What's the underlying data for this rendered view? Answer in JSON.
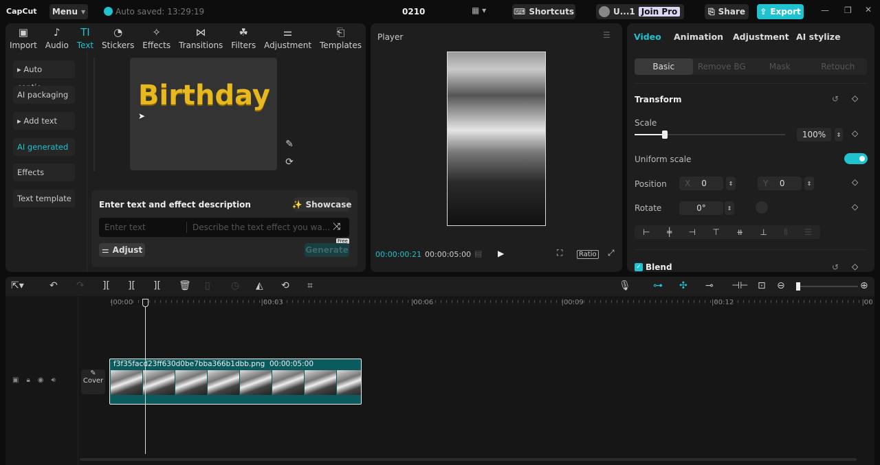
{
  "app": {
    "logo": "CapCut",
    "menu": "Menu",
    "autosave": "Auto saved: 13:29:19",
    "project": "0210",
    "shortcuts": "Shortcuts",
    "user": "U...1",
    "join_pro": "Join Pro",
    "share": "Share",
    "export": "Export"
  },
  "toolbar": [
    {
      "label": "Import",
      "icon": "▣"
    },
    {
      "label": "Audio",
      "icon": "♪"
    },
    {
      "label": "Text",
      "icon": "TI"
    },
    {
      "label": "Stickers",
      "icon": "◔"
    },
    {
      "label": "Effects",
      "icon": "✧"
    },
    {
      "label": "Transitions",
      "icon": "⋈"
    },
    {
      "label": "Filters",
      "icon": "☘"
    },
    {
      "label": "Adjustment",
      "icon": "⚌"
    },
    {
      "label": "Templates",
      "icon": "⎗"
    }
  ],
  "sidebar": [
    "▸ Auto captio...",
    "AI packaging",
    "▸ Add text",
    "AI generated",
    "Effects",
    "Text template"
  ],
  "preview": {
    "word": "Birthday"
  },
  "generator": {
    "title": "Enter text and effect description",
    "showcase": "Showcase",
    "text_placeholder": "Enter text",
    "desc_placeholder": "Describe the text effect you wa...",
    "adjust": "Adjust",
    "generate": "Generate",
    "free": "Free"
  },
  "player": {
    "title": "Player",
    "current": "00:00:00:21",
    "total": "00:00:05:00",
    "ratio": "Ratio"
  },
  "inspector": {
    "tabs": [
      "Video",
      "Animation",
      "Adjustment",
      "AI stylize"
    ],
    "subtabs": [
      "Basic",
      "Remove BG",
      "Mask",
      "Retouch"
    ],
    "transform": "Transform",
    "scale_label": "Scale",
    "scale_value": "100%",
    "scale_fraction": 0.2,
    "uniform": "Uniform scale",
    "uniform_on": true,
    "position": "Position",
    "x_label": "X",
    "x": "0",
    "y_label": "Y",
    "y": "0",
    "rotate": "Rotate",
    "rotate_value": "0°",
    "blend": "Blend"
  },
  "timeline": {
    "ruler": [
      "00:00",
      "00:03",
      "00:06",
      "00:09",
      "00:12",
      "00"
    ],
    "clip_name": "f3f35facd23ff630d0be7bba366b1dbb.png",
    "clip_duration": "00:00:05:00",
    "cover": "Cover"
  },
  "colors": {
    "accent": "#1fc3cf",
    "clip": "#0b5a5e"
  }
}
